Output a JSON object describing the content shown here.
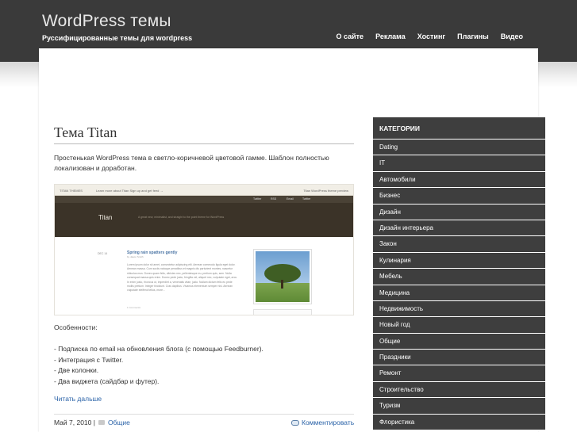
{
  "header": {
    "site_title": "WordPress темы",
    "tagline": "Руссифицированные темы для wordpress",
    "nav": [
      "О сайте",
      "Реклама",
      "Хостинг",
      "Плагины",
      "Видео"
    ]
  },
  "post": {
    "title": "Тема Titan",
    "excerpt": "Простенькая WordPress тема в светло-коричневой цветовой гамме. Шаблон полностью локализован и доработан.",
    "preview": {
      "topbar_left": "TITAN THEMES",
      "topbar_mid": "Learn more about Titan   Sign up and get feed →",
      "topbar_right": "Titan WordPress theme preview",
      "links": [
        "Twitter",
        "RSS",
        "Email",
        "Twitter"
      ],
      "name": "Titan",
      "description": "A great new, minimalist, and straight to the point theme for WordPress",
      "nav": [
        "Home",
        "About",
        "Archives",
        "Portfolio",
        "Contact"
      ],
      "post_date": "DEC 14",
      "post_title": "Spring rain spatters gently",
      "post_author": "by Jason Smith",
      "post_text": "Lorem ipsum dolor sit amet, consectetur adipiscing elit. Aenean commodo ligula eget dolor. Aenean massa. Cum sociis natoque penatibus et magnis dis parturient montes, nascetur ridiculus mus. Donec quam felis, ultricies nec, pellentesque eu, pretium quis, sem. Nulla consequat massa quis enim. Donec pede justo, fringilla vel, aliquet nec, vulputate eget, arcu. In enim justo, rhoncus ut, imperdiet a, venenatis vitae, justo. Nullam dictum felis eu pede mollis pretium. Integer tincidunt. Cras dapibus. Vivamus elementum semper nisi. Aenean vulputate eleifend tellus, more...",
      "comments": "1 Comments"
    },
    "features_heading": "Особенности:",
    "features": [
      "- Подписка по email на обновления блога (с помощью Feedburner).",
      "- Интеграция с Twitter.",
      "- Две колонки.",
      "- Два виджета (сайдбар и футер)."
    ],
    "read_more": "Читать дальше",
    "date": "Май 7, 2010 |",
    "category": "Общие",
    "comment_label": "Комментировать"
  },
  "sidebar": {
    "heading": "КАТЕГОРИИ",
    "items": [
      "Dating",
      "IT",
      "Автомобили",
      "Бизнес",
      "Дизайн",
      "Дизайн интерьера",
      "Закон",
      "Кулинария",
      "Мебель",
      "Медицина",
      "Недвижимость",
      "Новый год",
      "Общие",
      "Праздники",
      "Ремонт",
      "Строительство",
      "Туризм",
      "Флористика"
    ]
  },
  "colors": {
    "header_bg": "#3a3a3a",
    "sidebar_bg": "#3e3e3e",
    "link": "#2b63a8"
  }
}
